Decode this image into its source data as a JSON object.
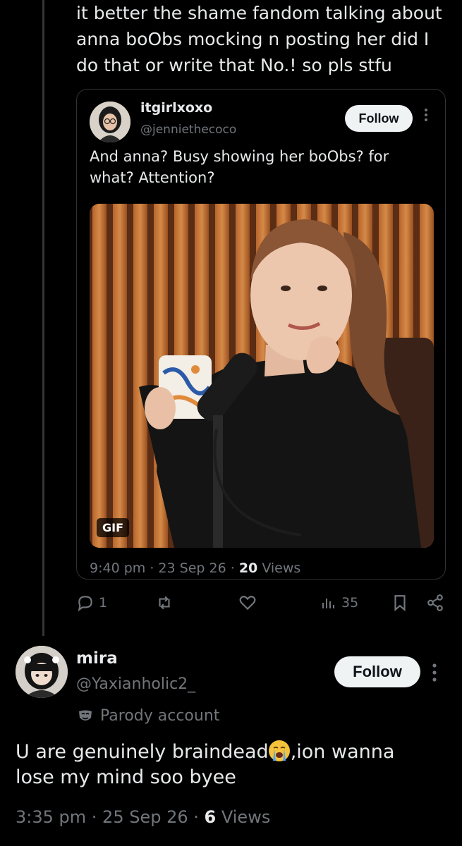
{
  "reply": {
    "lines": [
      "it better the shame fandom talking about",
      "anna boObs mocking n posting her did I",
      "do that or write that No.! so pls stfu"
    ]
  },
  "quoted_tweet": {
    "display_name": "itgirlxoxo",
    "handle": "@jenniethecoco",
    "follow_label": "Follow",
    "text_line1": "And anna? Busy showing her boObs? for",
    "text_line2": "what? Attention?",
    "media_badge": "GIF",
    "time": "9:40 pm",
    "date": "23 Sep 26",
    "views_count": "20",
    "views_label": "Views"
  },
  "actions": {
    "replies": "1",
    "analytics": "35"
  },
  "main_tweet": {
    "display_name": "mira",
    "handle": "@Yaxianholic2_",
    "follow_label": "Follow",
    "parody_label": "Parody account",
    "text_part1": "U are genuinely braindead",
    "emoji_name": "loudly-crying-face",
    "text_part2": ",ion wanna",
    "text_line2": "lose my mind soo byee",
    "time": "3:35 pm",
    "date": "25 Sep 26",
    "views_count": "6",
    "views_label": "Views"
  },
  "colors": {
    "background": "#000000",
    "text": "#e7e9ea",
    "secondary": "#71767b",
    "border": "#2f3336",
    "button_bg": "#eff3f4"
  }
}
